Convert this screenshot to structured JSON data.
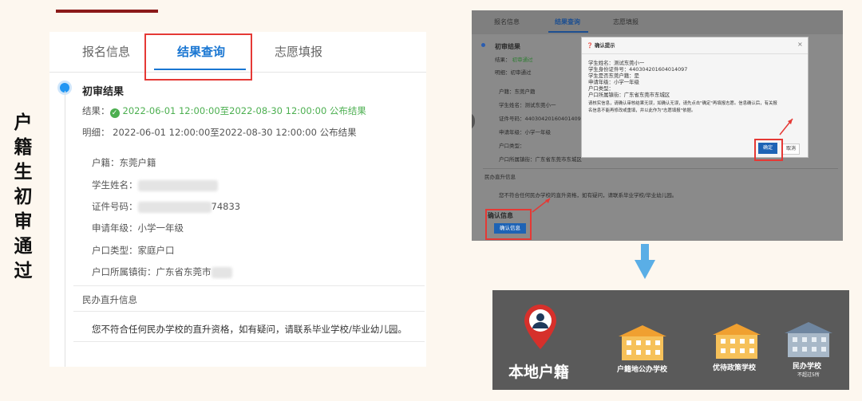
{
  "title_vertical": "户籍生初审通过",
  "left_panel": {
    "tabs": [
      {
        "label": "报名信息"
      },
      {
        "label": "结果查询"
      },
      {
        "label": "志愿填报"
      }
    ],
    "section_title": "初审结果",
    "result_label": "结果：",
    "result_value": "2022-06-01 12:00:00至2022-08-30 12:00:00 公布结果",
    "detail_label": "明细：",
    "detail_value": "2022-06-01 12:00:00至2022-08-30 12:00:00 公布结果",
    "fields": [
      {
        "label": "户籍：",
        "value": "东莞户籍"
      },
      {
        "label": "学生姓名：",
        "value": ""
      },
      {
        "label": "证件号码：",
        "value": "74833"
      },
      {
        "label": "申请年级：",
        "value": "小学一年级"
      },
      {
        "label": "户口类型：",
        "value": "家庭户口"
      },
      {
        "label": "户口所属镇街：",
        "value": "广东省东莞市"
      }
    ],
    "minban_title": "民办直升信息",
    "minban_text": "您不符合任何民办学校的直升资格，如有疑问，请联系毕业学校/毕业幼儿园。"
  },
  "right_panel": {
    "tabs": [
      {
        "label": "报名信息"
      },
      {
        "label": "结果查询"
      },
      {
        "label": "志愿填报"
      }
    ],
    "section_title": "初审结果",
    "result_label": "结果：",
    "result_value": "初审通过",
    "detail_label": "明细：",
    "detail_value": "初审通过",
    "fields": [
      {
        "label": "户籍：",
        "value": "东莞户籍"
      },
      {
        "label": "学生姓名：",
        "value": "测试东莞小一"
      },
      {
        "label": "证件号码：",
        "value": "44030420160401409​7"
      },
      {
        "label": "申请年级：",
        "value": "小学一年级"
      },
      {
        "label": "户口类型：",
        "value": ""
      },
      {
        "label": "户口所属镇街：",
        "value": "广东省东莞市东城区"
      }
    ],
    "minban_title": "民办直升信息",
    "minban_text": "您不符合任何民办学校的直升资格，如有疑问，请联系毕业学校/毕业幼儿园。",
    "confirm_title": "确认信息",
    "confirm_button": "确认信息",
    "modal": {
      "title": "确认提示",
      "lines": [
        "学生姓名：测试东莞小一",
        "学生身份证件号：440304201604014097",
        "学生是否东莞户籍：是",
        "申请年级：小学一年级",
        "户口类型：",
        "户口所属镇街：广东省东莞市东城区",
        "请核实信息，请确认审核结果无误，如确认无误，请先点击\"确定\"再填报志愿。信息确认后，有关报",
        "名信息不能再修改或重填，并以此作为\"志愿填报\"依据。"
      ],
      "ok": "确定",
      "cancel": "取消"
    }
  },
  "bottom_panel": {
    "main_label": "本地户籍",
    "schools": [
      {
        "label": "户籍地公办学校"
      },
      {
        "label": "优待政策学校"
      },
      {
        "label": "民办学校",
        "sub": "不超过5所"
      }
    ]
  },
  "colors": {
    "accent_blue": "#1976d2",
    "highlight_red": "#e53935",
    "success_green": "#4caf50",
    "arrow_blue": "#5aaee6",
    "pin_red": "#d6302b",
    "school_orange": "#f0a030",
    "school_gray": "#8fa3b8"
  }
}
